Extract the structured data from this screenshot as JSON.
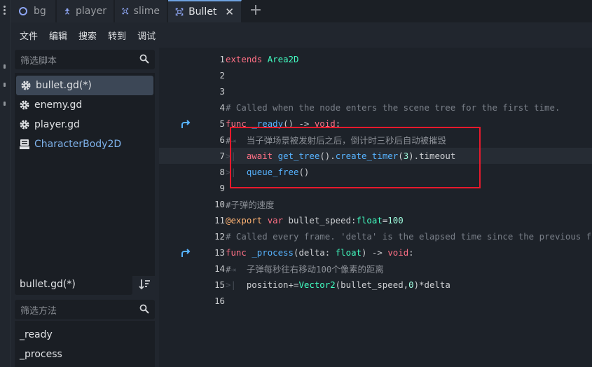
{
  "tabs": [
    {
      "label": "bg",
      "icon": "node-2d-icon",
      "active": false
    },
    {
      "label": "player",
      "icon": "person-node-icon",
      "active": false
    },
    {
      "label": "slime",
      "icon": "area-node-icon",
      "active": false
    },
    {
      "label": "Bullet",
      "icon": "area-node-icon",
      "active": true
    }
  ],
  "menu": [
    "文件",
    "编辑",
    "搜索",
    "转到",
    "调试"
  ],
  "script_panel": {
    "filter_placeholder": "筛选脚本",
    "scripts": [
      {
        "name": "bullet.gd(*)",
        "selected": true
      },
      {
        "name": "enemy.gd",
        "selected": false
      },
      {
        "name": "player.gd",
        "selected": false
      },
      {
        "name": "CharacterBody2D",
        "selected": false
      }
    ],
    "current_script": "bullet.gd(*)",
    "method_filter_placeholder": "筛选方法",
    "methods": [
      "_ready",
      "_process"
    ]
  },
  "editor": {
    "lines": [
      {
        "n": "1",
        "text": "extends Area2D"
      },
      {
        "n": "2",
        "text": ""
      },
      {
        "n": "3",
        "text": ""
      },
      {
        "n": "4",
        "text": "# Called when the node enters the scene tree for the first time."
      },
      {
        "n": "5",
        "text": "func _ready() -> void:"
      },
      {
        "n": "6",
        "text": "#   当子弹场景被发射后之后，倒计时三秒后自动被摧毁"
      },
      {
        "n": "7",
        "text": "    await get_tree().create_timer(3).timeout"
      },
      {
        "n": "8",
        "text": "    queue_free()"
      },
      {
        "n": "9",
        "text": ""
      },
      {
        "n": "10",
        "text": "#子弹的速度"
      },
      {
        "n": "11",
        "text": "@export var bullet_speed:float=100"
      },
      {
        "n": "12",
        "text": "# Called every frame. 'delta' is the elapsed time since the previous frame."
      },
      {
        "n": "13",
        "text": "func _process(delta: float) -> void:"
      },
      {
        "n": "14",
        "text": "#   子弹每秒往右移动100个像素的距离"
      },
      {
        "n": "15",
        "text": "    position+=Vector2(bullet_speed,0)*delta"
      },
      {
        "n": "16",
        "text": ""
      }
    ],
    "highlighted_line": "7"
  },
  "colors": {
    "accent": "#6ea2e0",
    "annotation_box": "#e8192c",
    "keyword": "#ff7085",
    "type": "#42ffc2",
    "function": "#57b3ff"
  }
}
